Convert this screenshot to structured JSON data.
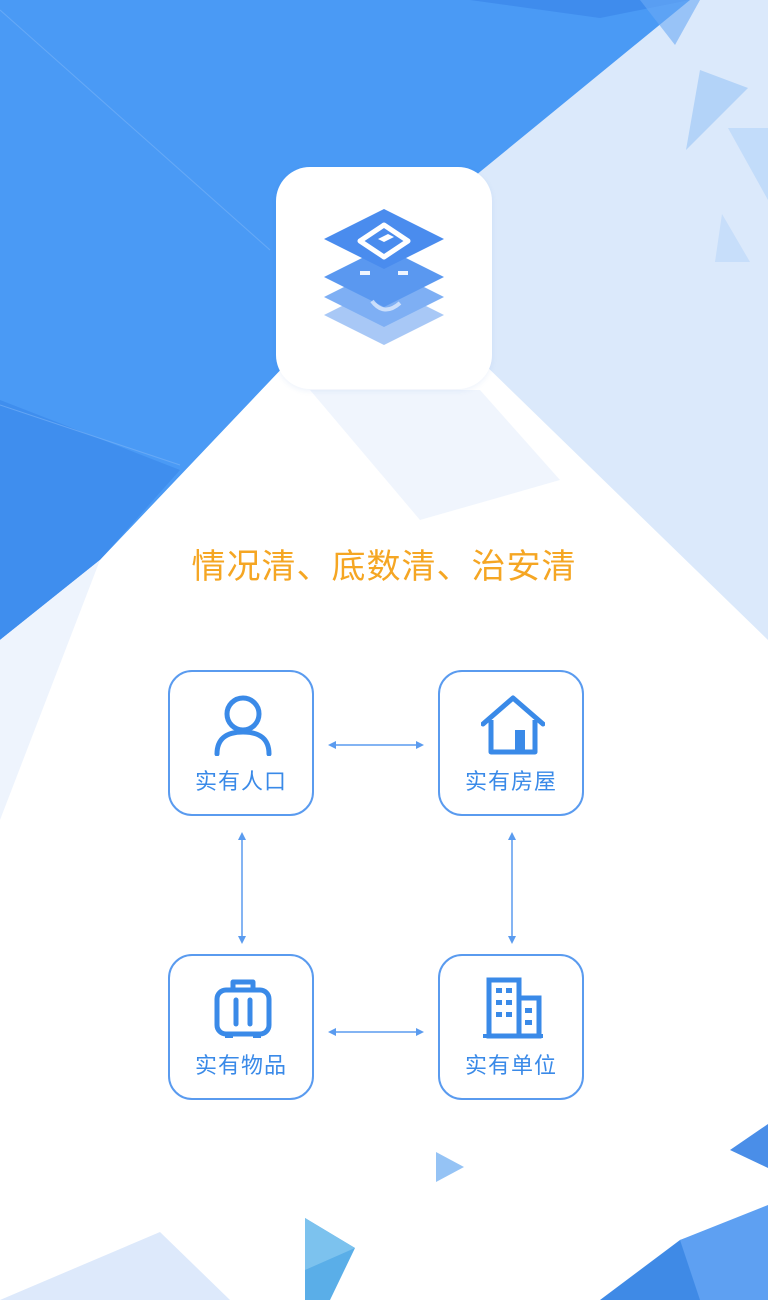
{
  "slogan": "情况清、底数清、治安清",
  "colors": {
    "primary_blue": "#4a9af5",
    "light_blue": "#dbe9fb",
    "accent_orange": "#f5a623",
    "card_border": "#5a9bef",
    "label_blue": "#3a8ae8"
  },
  "app_logo": {
    "icon": "stacked-layers-house-icon"
  },
  "cards": [
    {
      "id": "population",
      "label": "实有人口",
      "icon": "person-icon"
    },
    {
      "id": "housing",
      "label": "实有房屋",
      "icon": "house-icon"
    },
    {
      "id": "goods",
      "label": "实有物品",
      "icon": "suitcase-icon"
    },
    {
      "id": "unit",
      "label": "实有单位",
      "icon": "office-building-icon"
    }
  ]
}
